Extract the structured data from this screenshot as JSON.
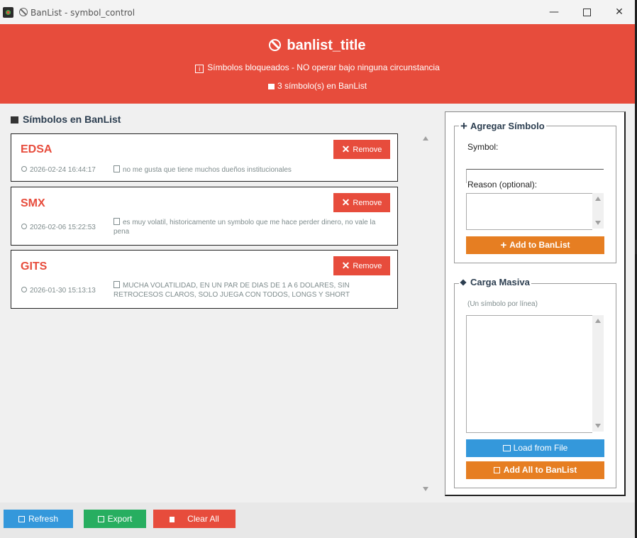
{
  "window": {
    "title": "BanList - symbol_control",
    "minimize": "—",
    "close": "✕"
  },
  "header": {
    "title": "banlist_title",
    "subtitle": "Símbolos bloqueados - NO operar bajo ninguna circunstancia",
    "count": "3 símbolo(s) en BanList",
    "color": "#e74c3c"
  },
  "list": {
    "title": "Símbolos en BanList",
    "remove_label": "Remove",
    "items": [
      {
        "symbol": "EDSA",
        "date": "2026-02-24 16:44:17",
        "reason": "no me gusta que tiene muchos dueños institucionales"
      },
      {
        "symbol": "SMX",
        "date": "2026-02-06 15:22:53",
        "reason": "es muy volatil, historicamente un symbolo que me hace perder dinero, no vale la pena"
      },
      {
        "symbol": "GITS",
        "date": "2026-01-30 15:13:13",
        "reason": "MUCHA VOLATILIDAD, EN UN PAR DE DIAS DE 1 A 6 DOLARES, SIN RETROCESOS CLAROS, SOLO JUEGA CON TODOS, LONGS Y SHORT"
      }
    ]
  },
  "add_panel": {
    "title": "Agregar Símbolo",
    "symbol_label": "Symbol:",
    "symbol_value": "",
    "reason_label": "Reason (optional):",
    "reason_value": "",
    "add_button": "Add to BanList",
    "color": "#e67e22"
  },
  "bulk_panel": {
    "title": "Carga Masiva",
    "hint": "(Un símbolo por línea)",
    "text_value": "",
    "load_button": "Load from File",
    "add_all_button": "Add All to BanList"
  },
  "bottom": {
    "refresh": "Refresh",
    "export": "Export",
    "clear_all": "Clear All"
  },
  "colors": {
    "blue": "#3498db",
    "green": "#27ae60",
    "red": "#e74c3c",
    "orange": "#e67e22"
  }
}
